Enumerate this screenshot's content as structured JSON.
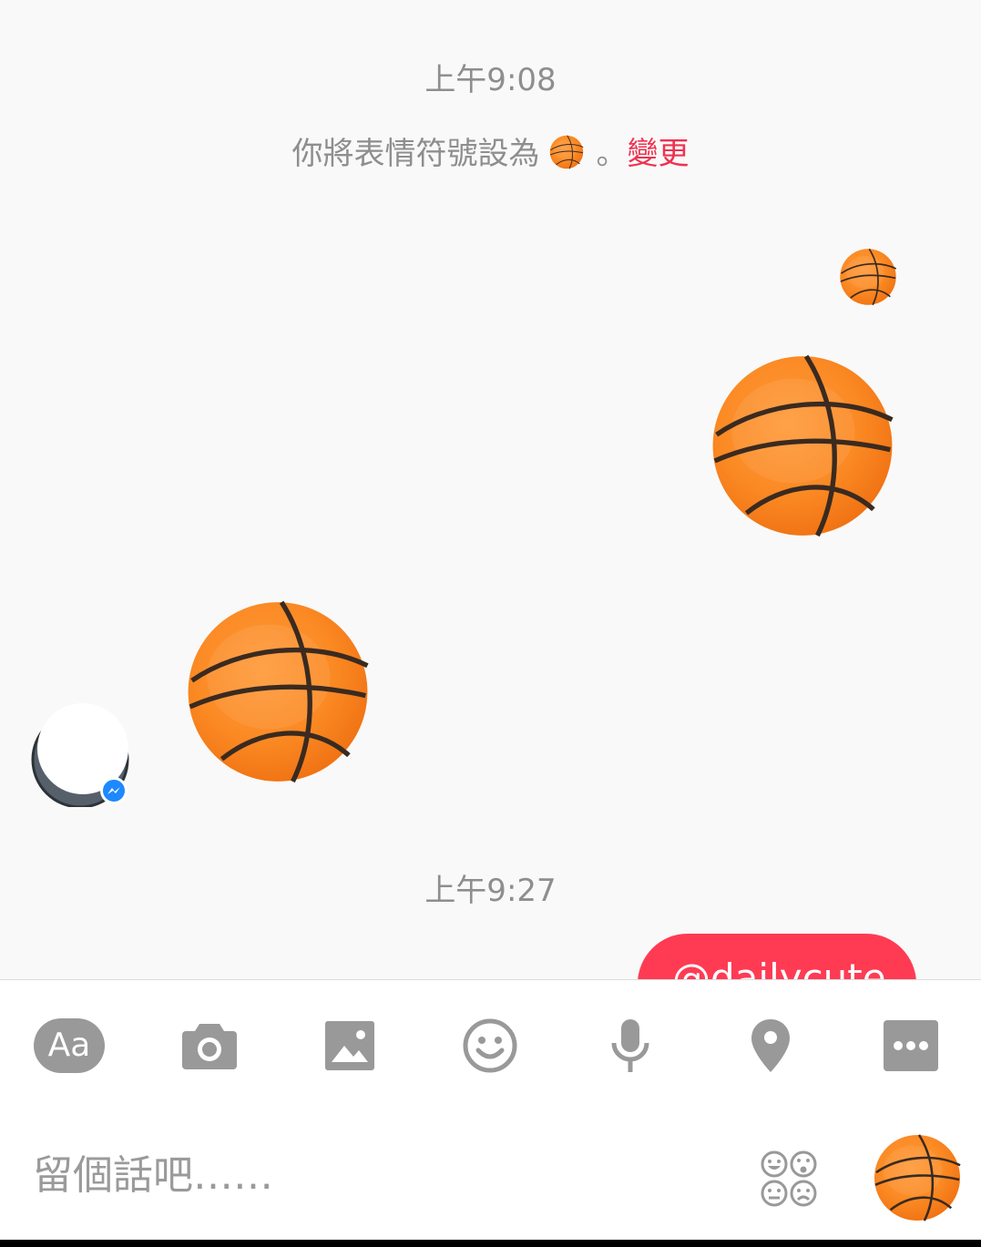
{
  "chat": {
    "timestamp_1": "上午9:08",
    "system_message": {
      "text": "你將表情符號設為",
      "emoji_icon": "basketball-icon",
      "period": "。",
      "change_link": "變更"
    },
    "timestamp_2": "上午9:27",
    "outgoing_bubble_text": "@dailycute"
  },
  "composer": {
    "tools": [
      {
        "name": "text-toggle",
        "label": "Aa"
      },
      {
        "name": "camera-icon"
      },
      {
        "name": "gallery-icon"
      },
      {
        "name": "emoji-icon"
      },
      {
        "name": "microphone-icon"
      },
      {
        "name": "location-pin-icon"
      },
      {
        "name": "more-icon"
      }
    ],
    "placeholder": "留個話吧……",
    "sticker_icon": "stickers-icon",
    "send_icon": "basketball-icon"
  },
  "colors": {
    "accent": "#ff3b54",
    "link": "#ef3150",
    "icon_gray": "#999999",
    "text_gray": "#8e8e8e",
    "ball_orange": "#f07a1a"
  }
}
